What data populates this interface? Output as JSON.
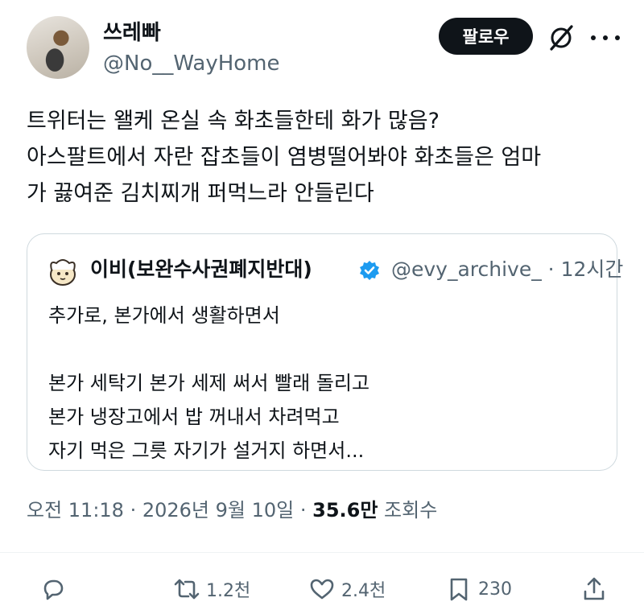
{
  "author": {
    "display_name": "쓰레빠",
    "handle": "@No__WayHome"
  },
  "follow_label": "팔로우",
  "tweet": {
    "lines": [
      "트위터는 왤케 온실 속 화초들한테 화가 많음?",
      "아스팔트에서 자란 잡초들이 염병떨어봐야 화초들은 엄마",
      "가 끓여준 김치찌개 퍼먹느라 안들린다"
    ]
  },
  "quote": {
    "display_name": "이비(보완수사권폐지반대)",
    "handle_time": "@evy_archive_ · 12시간",
    "lines": [
      "추가로, 본가에서 생활하면서",
      "",
      "본가 세탁기 본가 세제 써서 빨래 돌리고",
      "본가 냉장고에서 밥 꺼내서 차려먹고",
      "자기 먹은 그릇 자기가 설거지 하면서..."
    ]
  },
  "meta": {
    "time_date": "오전 11:18 · 2026년 9월 10일 · ",
    "views_count": "35.6만",
    "views_label": " 조회수"
  },
  "actions": {
    "reply": "",
    "retweet": "1.2천",
    "like": "2.4천",
    "bookmark": "230"
  },
  "colors": {
    "text": "#0f1419",
    "secondary": "#536471",
    "verified": "#1d9bf0",
    "border": "#cfd9de"
  },
  "icons": [
    "grok-icon",
    "more-icon",
    "verified-badge-icon",
    "reply-icon",
    "retweet-icon",
    "like-icon",
    "bookmark-icon",
    "share-icon"
  ]
}
